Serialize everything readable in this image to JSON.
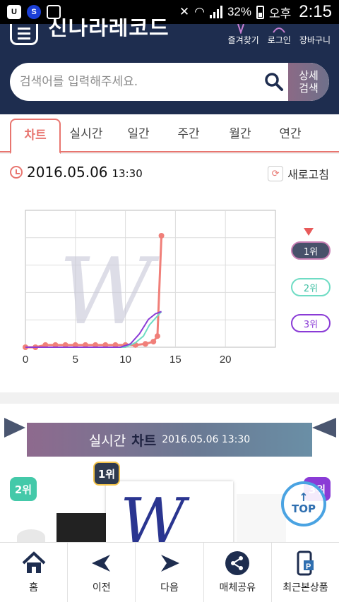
{
  "status_bar": {
    "battery": "32%",
    "ampm": "오후",
    "time": "2:15"
  },
  "header": {
    "logo": "신나라레코드",
    "links": [
      {
        "label": "즐겨찾기",
        "icon": "star-icon"
      },
      {
        "label": "로그인",
        "icon": "login-icon"
      },
      {
        "label": "장바구니",
        "icon": "cart-icon"
      }
    ],
    "search": {
      "placeholder": "검색어를 입력해주세요.",
      "adv_line1": "상세",
      "adv_line2": "검색"
    }
  },
  "tabs": [
    "차트",
    "실시간",
    "일간",
    "주간",
    "월간",
    "연간"
  ],
  "active_tab": 0,
  "chart_header": {
    "date": "2016.05.06",
    "time": "13:30",
    "refresh_label": "새로고침"
  },
  "chart_data": {
    "type": "line",
    "xlim": [
      0,
      25
    ],
    "x_ticks": [
      "0",
      "5",
      "10",
      "15",
      "20"
    ],
    "grid": true,
    "series": [
      {
        "name": "1위",
        "color": "#f07f79",
        "x": [
          0,
          1,
          2,
          3,
          4,
          5,
          6,
          7,
          8,
          9,
          10,
          11,
          12,
          12.8,
          13.2,
          13.6
        ],
        "y": [
          0,
          0,
          0.02,
          0.02,
          0.02,
          0.02,
          0.02,
          0.02,
          0.02,
          0.02,
          0.02,
          0.02,
          0.03,
          0.05,
          0.1,
          1.0
        ]
      },
      {
        "name": "2위",
        "color": "#6fdcc4",
        "x": [
          0,
          9,
          10,
          11,
          11.8,
          12.4,
          13.6
        ],
        "y": [
          0,
          0,
          0,
          0.04,
          0.1,
          0.2,
          0.32
        ]
      },
      {
        "name": "3위",
        "color": "#8a3bd6",
        "x": [
          0,
          9.5,
          10.5,
          11.4,
          12.3,
          13,
          13.6
        ],
        "y": [
          0,
          0,
          0.03,
          0.12,
          0.25,
          0.3,
          0.32
        ]
      }
    ],
    "legend": [
      "1위",
      "2위",
      "3위"
    ]
  },
  "realtime": {
    "title1": "실시간",
    "title2": "차트",
    "datetime": "2016.05.06 13:30",
    "ranks": [
      "1위",
      "2위",
      "3위"
    ],
    "top_label": "TOP"
  },
  "bottom_nav": [
    {
      "label": "홈",
      "icon": "home-icon"
    },
    {
      "label": "이전",
      "icon": "prev-icon"
    },
    {
      "label": "다음",
      "icon": "next-icon"
    },
    {
      "label": "매체공유",
      "icon": "share-icon"
    },
    {
      "label": "최근본상품",
      "icon": "recent-items-icon"
    }
  ]
}
